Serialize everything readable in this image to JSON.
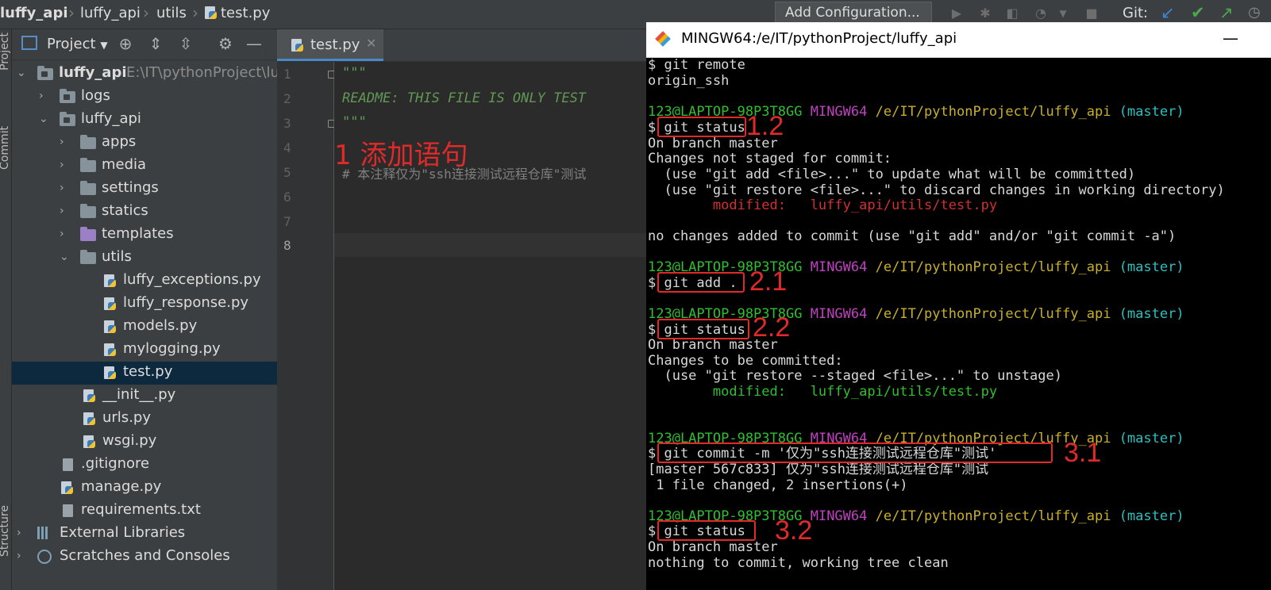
{
  "breadcrumb": {
    "project": "luffy_api",
    "package": "luffy_api",
    "folder": "utils",
    "file": "test.py"
  },
  "toolbar": {
    "add_configuration": "Add Configuration...",
    "git_label": "Git:"
  },
  "tool_stripe": {
    "project_tab": "Project",
    "commit_tab": "Commit",
    "structure_tab": "Structure"
  },
  "project_panel": {
    "title": "Project",
    "tree": {
      "root": "luffy_api",
      "root_path": "E:\\IT\\pythonProject\\luffy_api",
      "logs": "logs",
      "luffy_api": "luffy_api",
      "apps": "apps",
      "media": "media",
      "settings": "settings",
      "statics": "statics",
      "templates": "templates",
      "utils": "utils",
      "luffy_exceptions": "luffy_exceptions.py",
      "luffy_response": "luffy_response.py",
      "models": "models.py",
      "mylogging": "mylogging.py",
      "test": "test.py",
      "init": "__init__.py",
      "urls": "urls.py",
      "wsgi": "wsgi.py",
      "gitignore": ".gitignore",
      "manage": "manage.py",
      "requirements": "requirements.txt",
      "external_libraries": "External Libraries",
      "scratches": "Scratches and Consoles"
    }
  },
  "editor": {
    "tab_label": "test.py",
    "line_numbers": [
      "1",
      "2",
      "3",
      "4",
      "5",
      "6",
      "7",
      "8"
    ],
    "lines": {
      "l1": "\"\"\"",
      "l2": "README: THIS FILE IS ONLY TEST",
      "l3": "\"\"\"",
      "l5": "#  本注释仅为\"ssh连接测试远程仓库\"测试"
    },
    "annotation": "1 添加语句"
  },
  "terminal": {
    "title": "MINGW64:/e/IT/pythonProject/luffy_api",
    "prompt_user": "123@LAPTOP-98P3T8GG",
    "prompt_env": "MINGW64",
    "prompt_path": "/e/IT/pythonProject/luffy_api",
    "prompt_branch": "(master)",
    "lines": {
      "git_remote": "$ git remote",
      "origin_ssh": "origin_ssh",
      "cmd_status_1": "$ git status",
      "on_branch_1": "On branch master",
      "not_staged": "Changes not staged for commit:",
      "hint_add": "  (use \"git add <file>...\" to update what will be committed)",
      "hint_restore": "  (use \"git restore <file>...\" to discard changes in working directory)",
      "modified_1": "        modified:   luffy_api/utils/test.py",
      "no_changes": "no changes added to commit (use \"git add\" and/or \"git commit -a\")",
      "cmd_add": "$ git add .",
      "cmd_status_2": "$ git status",
      "on_branch_2": "On branch master",
      "to_be_committed": "Changes to be committed:",
      "hint_unstage": "  (use \"git restore --staged <file>...\" to unstage)",
      "modified_2": "        modified:   luffy_api/utils/test.py",
      "cmd_commit": "$ git commit -m '仅为\"ssh连接测试远程仓库\"测试'",
      "commit_result": "[master 567c833] 仅为\"ssh连接测试远程仓库\"测试",
      "commit_stats": " 1 file changed, 2 insertions(+)",
      "cmd_status_3": "$ git status",
      "on_branch_3": "On branch master",
      "clean": "nothing to commit, working tree clean"
    },
    "annotations": {
      "a12": "1.2",
      "a21": "2.1",
      "a22": "2.2",
      "a31": "3.1",
      "a32": "3.2"
    }
  },
  "colors": {
    "ide_bg": "#2b2b2b",
    "panel_bg": "#3c3f41",
    "selection": "#0d293e",
    "annotation_red": "#e02a2a",
    "prompt_green": "#2fbf2f",
    "prompt_magenta": "#c040c0",
    "prompt_yellow": "#c8b02a",
    "prompt_cyan": "#2cc0c0"
  }
}
